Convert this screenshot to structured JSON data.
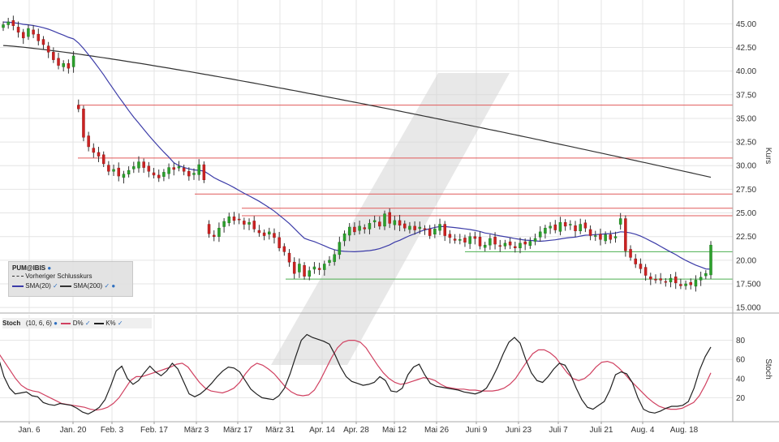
{
  "chart_data": [
    {
      "type": "candlestick",
      "symbol": "PUM@IBIS",
      "ylabel": "Kurs",
      "ylim": [
        14.5,
        47.0
      ],
      "yticks": [
        45.0,
        42.5,
        40.0,
        37.5,
        35.0,
        32.5,
        30.0,
        27.5,
        25.0,
        22.5,
        20.0,
        17.5,
        15.0
      ],
      "ytick_labels": [
        "45.00",
        "42.50",
        "40.00",
        "37.50",
        "35.00",
        "32.50",
        "30.00",
        "27.50",
        "25.00",
        "22.50",
        "20.00",
        "17.500",
        "15.000"
      ],
      "xticks": [
        "Jan. 6",
        "Jan. 20",
        "Feb. 3",
        "Feb. 17",
        "März 3",
        "März 17",
        "März 31",
        "Apr. 14",
        "Apr. 28",
        "Mai 12",
        "Mai 26",
        "Juni 9",
        "Juni 23",
        "Juli 7",
        "Juli 21",
        "Aug. 4",
        "Aug. 18"
      ],
      "grid": true,
      "legend": {
        "placement": "bottom-left",
        "title": "PUM@IBIS",
        "entries": [
          "Vorheriger Schlusskurs",
          "SMA(20)",
          "SMA(200)"
        ]
      },
      "candles_close": [
        44.9,
        45.2,
        44.8,
        44.1,
        43.5,
        44.5,
        43.9,
        43.2,
        42.8,
        42.0,
        41.2,
        40.6,
        40.8,
        40.3,
        41.6,
        36.0,
        33.0,
        32.0,
        31.4,
        31.0,
        30.2,
        29.4,
        29.6,
        28.9,
        29.1,
        29.5,
        29.9,
        30.4,
        29.8,
        29.4,
        29.0,
        28.7,
        29.3,
        29.8,
        29.6,
        29.9,
        29.4,
        28.9,
        29.2,
        30.1,
        28.5,
        22.8,
        22.5,
        23.4,
        24.1,
        24.6,
        24.2,
        24.3,
        23.8,
        24.0,
        23.3,
        22.9,
        22.6,
        23.0,
        22.4,
        21.3,
        20.9,
        19.8,
        18.6,
        19.6,
        18.3,
        18.9,
        19.3,
        19.0,
        19.6,
        20.0,
        20.6,
        21.9,
        22.8,
        23.5,
        23.0,
        23.6,
        23.3,
        23.9,
        24.2,
        23.6,
        24.9,
        23.9,
        24.2,
        23.7,
        23.4,
        23.6,
        23.2,
        23.5,
        23.3,
        22.6,
        23.3,
        23.8,
        22.6,
        22.4,
        22.1,
        22.2,
        21.9,
        22.5,
        22.3,
        21.5,
        21.6,
        22.3,
        21.7,
        21.5,
        21.8,
        21.6,
        21.3,
        21.8,
        21.7,
        22.0,
        22.3,
        23.0,
        23.4,
        23.6,
        23.2,
        24.0,
        23.6,
        23.8,
        23.1,
        23.8,
        23.4,
        22.6,
        22.6,
        22.2,
        22.7,
        22.2,
        22.5,
        24.4,
        21.0,
        20.3,
        19.6,
        19.1,
        18.4,
        18.0,
        17.9,
        17.9,
        17.7,
        18.1,
        17.6,
        17.3,
        17.5,
        17.4,
        17.9,
        18.2,
        18.6,
        21.6
      ],
      "sma20_first_x_index": 0,
      "reference_lines": {
        "red": [
          36.4,
          30.8,
          27.0,
          25.5,
          24.7
        ],
        "green": [
          20.9,
          18.0
        ]
      }
    },
    {
      "type": "line",
      "title": "Stoch",
      "params": "(10, 6, 6)",
      "ylabel": "Stoch",
      "ylim": [
        0,
        100
      ],
      "yticks": [
        20,
        40,
        60,
        80
      ],
      "series": [
        {
          "name": "D%",
          "color": "#d04060",
          "values": [
            67,
            58,
            49,
            40,
            33,
            29,
            27,
            26,
            23,
            20,
            17,
            14,
            13,
            12,
            11,
            10,
            8,
            7,
            8,
            10,
            14,
            20,
            29,
            38,
            42,
            42,
            44,
            46,
            48,
            50,
            52,
            55,
            56,
            52,
            44,
            36,
            30,
            27,
            26,
            25,
            27,
            30,
            36,
            45,
            52,
            56,
            54,
            50,
            45,
            38,
            31,
            26,
            23,
            22,
            23,
            28,
            38,
            50,
            62,
            72,
            78,
            80,
            80,
            78,
            72,
            63,
            54,
            46,
            40,
            36,
            34,
            35,
            37,
            39,
            41,
            40,
            38,
            34,
            31,
            30,
            29,
            29,
            28,
            28,
            27,
            27,
            27,
            28,
            30,
            34,
            40,
            49,
            58,
            66,
            70,
            70,
            67,
            62,
            54,
            46,
            40,
            38,
            40,
            45,
            52,
            57,
            58,
            56,
            51,
            45,
            38,
            32,
            26,
            20,
            15,
            11,
            9,
            8,
            8,
            9,
            12,
            15,
            22,
            33,
            46
          ]
        },
        {
          "name": "K%",
          "color": "#202020",
          "values": [
            62,
            42,
            30,
            24,
            25,
            26,
            22,
            21,
            15,
            13,
            12,
            14,
            13,
            12,
            9,
            5,
            3,
            6,
            10,
            18,
            32,
            48,
            53,
            40,
            34,
            38,
            46,
            53,
            47,
            43,
            48,
            56,
            50,
            37,
            24,
            21,
            24,
            29,
            35,
            42,
            48,
            52,
            51,
            47,
            38,
            29,
            24,
            20,
            19,
            18,
            22,
            30,
            45,
            63,
            80,
            86,
            83,
            81,
            79,
            76,
            65,
            52,
            42,
            37,
            35,
            33,
            34,
            36,
            42,
            38,
            27,
            26,
            30,
            44,
            52,
            55,
            44,
            35,
            32,
            31,
            30,
            29,
            28,
            26,
            25,
            24,
            26,
            30,
            40,
            52,
            66,
            78,
            83,
            77,
            60,
            46,
            38,
            36,
            42,
            50,
            56,
            54,
            44,
            30,
            18,
            10,
            8,
            12,
            16,
            28,
            44,
            47,
            45,
            36,
            20,
            8,
            5,
            4,
            6,
            9,
            11,
            11,
            12,
            16,
            30,
            49,
            63,
            73
          ]
        }
      ]
    }
  ]
}
